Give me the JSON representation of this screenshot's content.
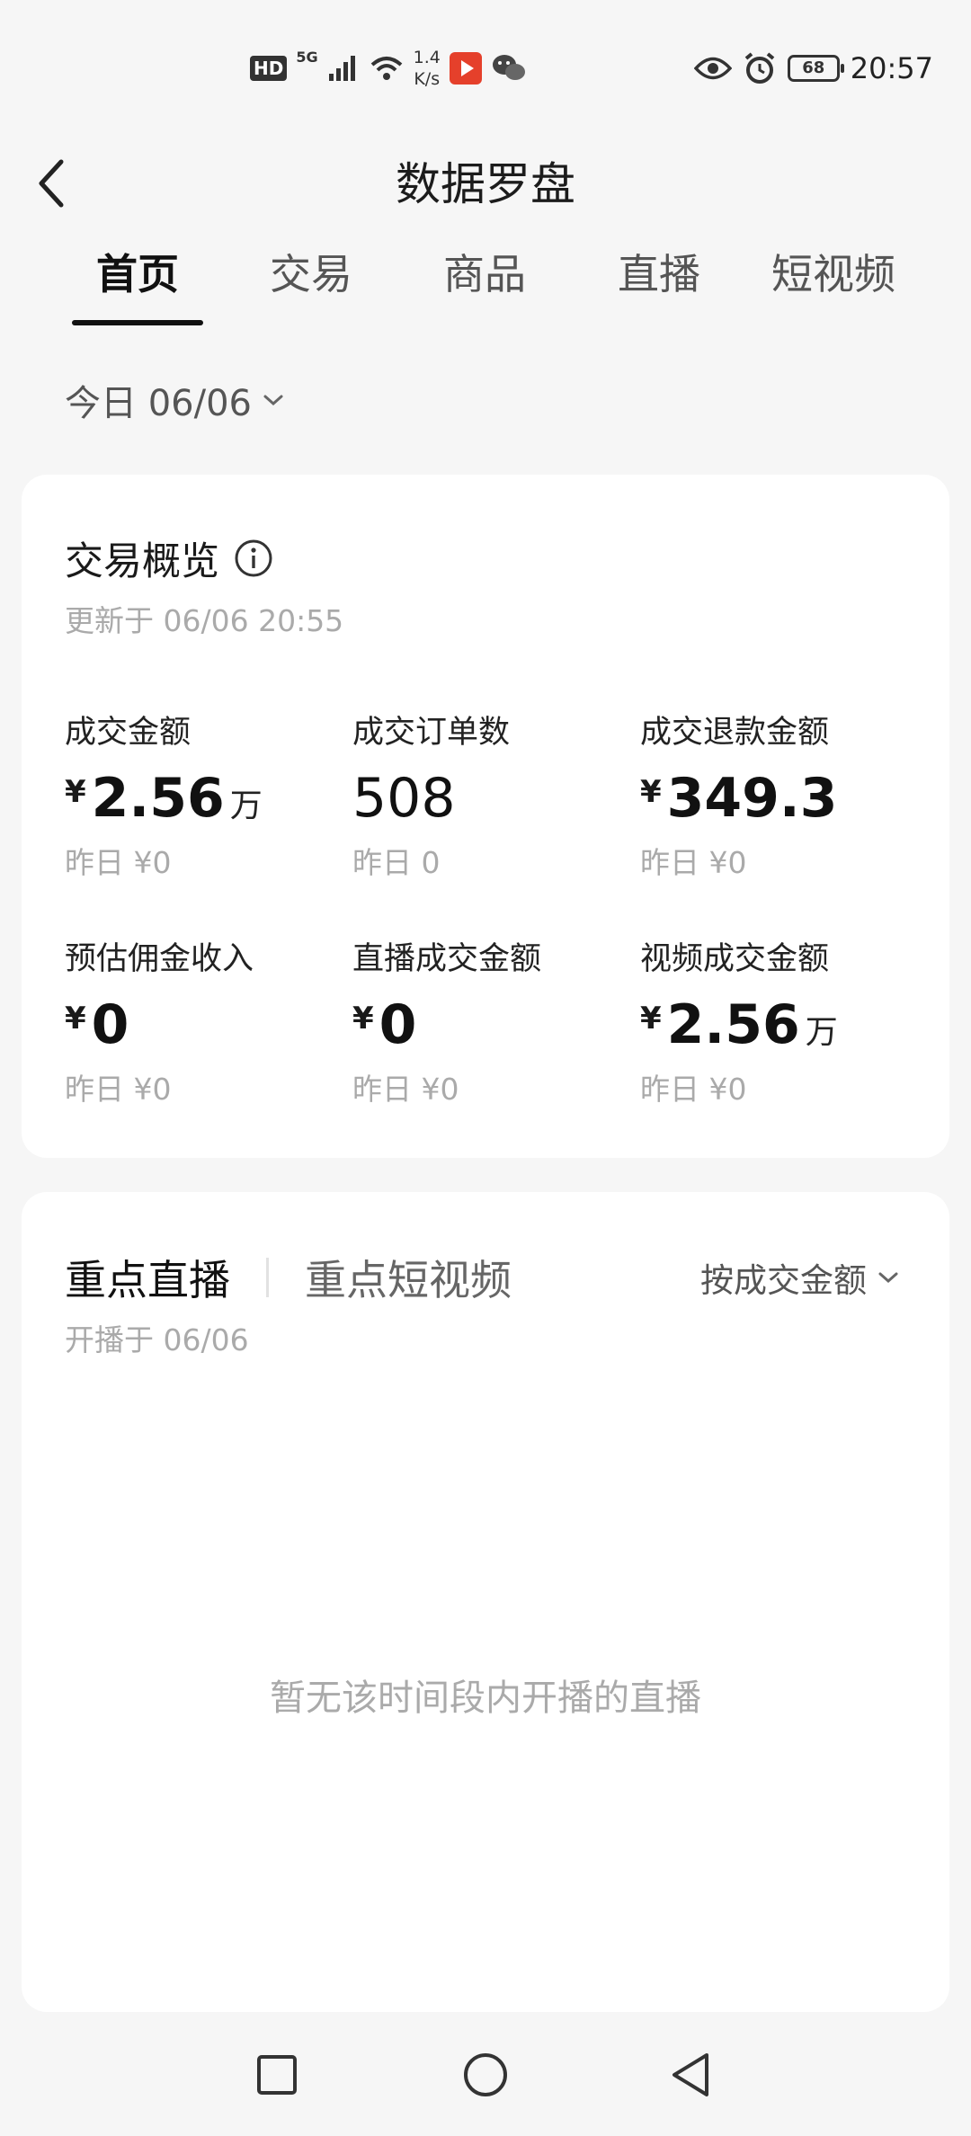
{
  "status_bar": {
    "hd": "HD",
    "network": "5G",
    "speed_value": "1.4",
    "speed_unit": "K/s",
    "battery": "68",
    "time": "20:57",
    "icons": [
      "signal-icon",
      "wifi-icon",
      "video-app-icon",
      "wechat-icon",
      "eye-icon",
      "alarm-icon",
      "battery-icon"
    ]
  },
  "header": {
    "title": "数据罗盘",
    "back_icon": "chevron-left-icon"
  },
  "tabs": [
    {
      "label": "首页",
      "active": true
    },
    {
      "label": "交易",
      "active": false
    },
    {
      "label": "商品",
      "active": false
    },
    {
      "label": "直播",
      "active": false
    },
    {
      "label": "短视频",
      "active": false
    }
  ],
  "date_selector": {
    "label": "今日 06/06",
    "icon": "chevron-down-icon"
  },
  "overview": {
    "title": "交易概览",
    "info_icon": "info-icon",
    "updated": "更新于 06/06 20:55",
    "metrics": [
      {
        "label": "成交金额",
        "currency": "¥",
        "value": "2.56",
        "unit": "万",
        "yesterday": "昨日 ¥0"
      },
      {
        "label": "成交订单数",
        "currency": "",
        "value": "508",
        "unit": "",
        "yesterday": "昨日 0"
      },
      {
        "label": "成交退款金额",
        "currency": "¥",
        "value": "349.3",
        "unit": "",
        "yesterday": "昨日 ¥0"
      },
      {
        "label": "预估佣金收入",
        "currency": "¥",
        "value": "0",
        "unit": "",
        "yesterday": "昨日 ¥0"
      },
      {
        "label": "直播成交金额",
        "currency": "¥",
        "value": "0",
        "unit": "",
        "yesterday": "昨日 ¥0"
      },
      {
        "label": "视频成交金额",
        "currency": "¥",
        "value": "2.56",
        "unit": "万",
        "yesterday": "昨日 ¥0"
      }
    ]
  },
  "live_section": {
    "tabs": [
      {
        "label": "重点直播",
        "active": true
      },
      {
        "label": "重点短视频",
        "active": false
      }
    ],
    "sort_label": "按成交金额",
    "sort_icon": "chevron-down-icon",
    "subtitle": "开播于 06/06",
    "empty_message": "暂无该时间段内开播的直播"
  },
  "nav_bar": {
    "buttons": [
      "recent-apps-icon",
      "home-icon",
      "back-triangle-icon"
    ]
  },
  "colors": {
    "background": "#f6f6f6",
    "card": "#ffffff",
    "text_primary": "#111111",
    "text_secondary": "#aaaaaa"
  }
}
